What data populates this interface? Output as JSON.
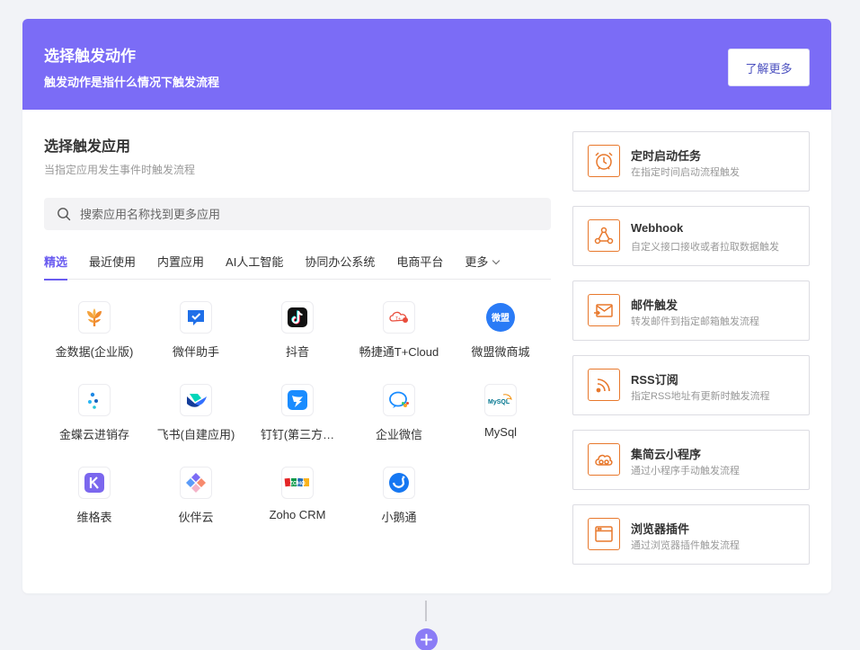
{
  "header": {
    "title": "选择触发动作",
    "subtitle": "触发动作是指什么情况下触发流程",
    "learn_more": "了解更多"
  },
  "apps_section": {
    "title": "选择触发应用",
    "subtitle": "当指定应用发生事件时触发流程"
  },
  "search": {
    "placeholder": "搜索应用名称找到更多应用"
  },
  "tabs": [
    "精选",
    "最近使用",
    "内置应用",
    "AI人工智能",
    "协同办公系统",
    "电商平台",
    "更多"
  ],
  "apps": [
    {
      "name": "金数据(企业版)",
      "icon": "jinshuju-icon"
    },
    {
      "name": "微伴助手",
      "icon": "weiban-icon"
    },
    {
      "name": "抖音",
      "icon": "douyin-icon"
    },
    {
      "name": "畅捷通T+Cloud",
      "icon": "chanjet-icon"
    },
    {
      "name": "微盟微商城",
      "icon": "weimeng-icon"
    },
    {
      "name": "金蝶云进销存",
      "icon": "kingdee-icon"
    },
    {
      "name": "飞书(自建应用)",
      "icon": "feishu-icon"
    },
    {
      "name": "钉钉(第三方…",
      "icon": "dingtalk-icon"
    },
    {
      "name": "企业微信",
      "icon": "wecom-icon"
    },
    {
      "name": "MySql",
      "icon": "mysql-icon"
    },
    {
      "name": "维格表",
      "icon": "vika-icon"
    },
    {
      "name": "伙伴云",
      "icon": "huoban-icon"
    },
    {
      "name": "Zoho CRM",
      "icon": "zoho-icon"
    },
    {
      "name": "小鹅通",
      "icon": "xiaoe-icon"
    }
  ],
  "icon_labels": {
    "weimeng": "微盟",
    "mysql": "MySQL",
    "zoho": "ZOHO"
  },
  "triggers": [
    {
      "name": "定时启动任务",
      "desc": "在指定时间启动流程触发",
      "icon": "alarm-clock-icon"
    },
    {
      "name": "Webhook",
      "desc": "自定义接口接收或者拉取数据触发",
      "icon": "webhook-icon"
    },
    {
      "name": "邮件触发",
      "desc": "转发邮件到指定邮箱触发流程",
      "icon": "mail-icon"
    },
    {
      "name": "RSS订阅",
      "desc": "指定RSS地址有更新时触发流程",
      "icon": "rss-icon"
    },
    {
      "name": "集简云小程序",
      "desc": "通过小程序手动触发流程",
      "icon": "cloud-icon"
    },
    {
      "name": "浏览器插件",
      "desc": "通过浏览器插件触发流程",
      "icon": "browser-window-icon"
    }
  ],
  "colors": {
    "header_bg": "#7b6cf6",
    "accent": "#6a5cf0",
    "trigger_icon": "#e8782c"
  }
}
